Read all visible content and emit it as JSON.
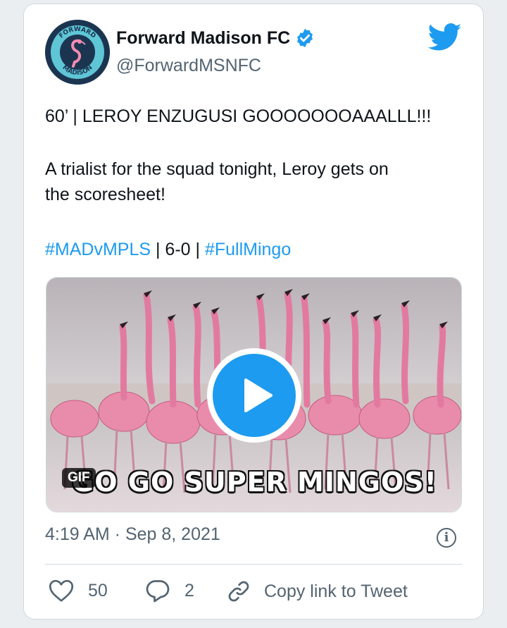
{
  "tweet": {
    "author": {
      "name": "Forward Madison FC",
      "handle": "@ForwardMSNFC",
      "verified": true,
      "avatar_text_top": "FORWARD",
      "avatar_text_bottom": "MADISON"
    },
    "text": {
      "line1": "60’ | LEROY ENZUGUSI GOOOOOOOAAALLL!!!",
      "line2": "A trialist for the squad tonight, Leroy gets on",
      "line3": "the scoresheet!",
      "hashtag1": "#MADvMPLS",
      "separator1": " | 6-0 | ",
      "hashtag2": "#FullMingo"
    },
    "media": {
      "type": "GIF",
      "badge": "GIF",
      "caption": "GO GO SUPER MINGOS!"
    },
    "timestamp": "4:19 AM · Sep 8, 2021",
    "actions": {
      "likes": "50",
      "replies": "2",
      "copy_link": "Copy link to Tweet"
    }
  },
  "colors": {
    "accent": "#1d9bf0",
    "text": "#0f1419",
    "muted": "#536471",
    "border": "#cfd9de",
    "background": "#ebeef0"
  },
  "icons": [
    "twitter-bird-icon",
    "verified-badge-icon",
    "play-icon",
    "info-icon",
    "heart-icon",
    "reply-icon",
    "link-icon"
  ]
}
